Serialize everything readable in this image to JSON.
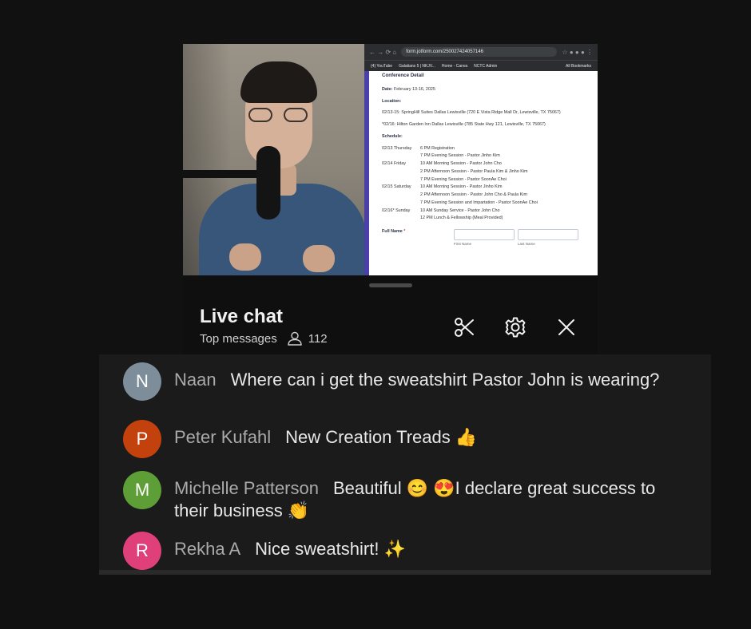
{
  "screen_share": {
    "url": "form.jotform.com/250027424057146",
    "bookmarks": [
      "(4) YouTube",
      "Galatians 5 | NKJV...",
      "Home - Canva",
      "NCTC Admin",
      "All Bookmarks"
    ],
    "doc": {
      "heading": "Conference Detail",
      "date_label": "Date:",
      "date_value": "February 13-16, 2025",
      "location_label": "Location:",
      "location_1": "02/13-15: SpringHill Suites Dallas Lewisville (720 E Vista Ridge Mall Dr, Lewisville, TX 75067)",
      "location_2": "*02/16: Hilton Garden Inn Dallas Lewisville (785 State Hwy 121, Lewisville, TX 75067)",
      "schedule_label": "Schedule:",
      "schedule": [
        {
          "day": "02/13 Thursday",
          "item": "6 PM Registration"
        },
        {
          "day": "",
          "item": "7 PM Evening Session - Pastor Jinho Kim"
        },
        {
          "day": "02/14 Friday",
          "item": "10 AM Morning Session - Pastor John Cho"
        },
        {
          "day": "",
          "item": "2 PM Afternoon Session - Pastor Paula Kim & Jinho Kim"
        },
        {
          "day": "",
          "item": "7 PM Evening Session - Pastor SoonAe Choi"
        },
        {
          "day": "02/15 Saturday",
          "item": "10 AM Morning Session - Pastor Jinho Kim"
        },
        {
          "day": "",
          "item": "2 PM Afternoon Session - Pastor John Cho & Paula Kim"
        },
        {
          "day": "",
          "item": "7 PM Evening Session and Impartation - Pastor SoonAe Choi"
        },
        {
          "day": "02/16* Sunday",
          "item": "10 AM Sunday Service - Pastor John Cho"
        },
        {
          "day": "",
          "item": "12 PM Lunch & Fellowship (Meal Provided)"
        }
      ],
      "full_name_label": "Full Name",
      "required_mark": "*",
      "first_name_sub": "First Name",
      "last_name_sub": "Last Name"
    }
  },
  "chat": {
    "title": "Live chat",
    "mode": "Top messages",
    "viewer_count": "112",
    "icons": [
      "scissors-icon",
      "gear-icon",
      "close-icon"
    ],
    "messages": [
      {
        "initial": "N",
        "avatar_color": "#7d8e9a",
        "author": "Naan",
        "text": "Where can i get the sweatshirt Pastor John is wearing?"
      },
      {
        "initial": "P",
        "avatar_color": "#c2410c",
        "author": "Peter Kufahl",
        "text": "New Creation Treads 👍"
      },
      {
        "initial": "M",
        "avatar_color": "#5d9e36",
        "author": "Michelle Patterson",
        "text": "Beautiful 😊 😍I declare great success to their business 👏"
      },
      {
        "initial": "R",
        "avatar_color": "#e0407a",
        "author": "Rekha A",
        "text": "Nice sweatshirt! ✨"
      }
    ]
  }
}
